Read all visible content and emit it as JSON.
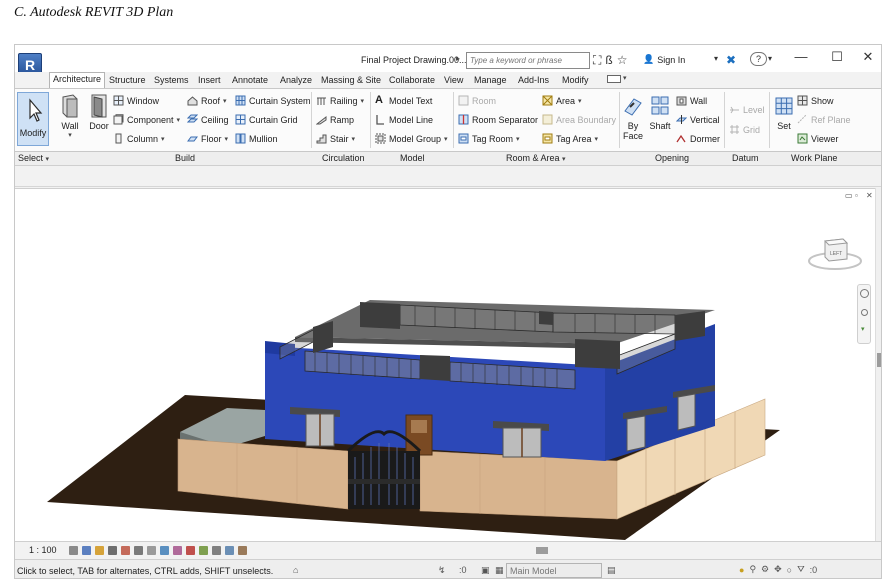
{
  "caption": "C.    Autodesk REVIT 3D Plan",
  "titlebar": {
    "logo": "R",
    "document_title": "Final Project Drawing.00...",
    "search_placeholder": "Type a keyword or phrase",
    "sign_in": "Sign In"
  },
  "tabs": [
    "Architecture",
    "Structure",
    "Systems",
    "Insert",
    "Annotate",
    "Analyze",
    "Massing & Site",
    "Collaborate",
    "View",
    "Manage",
    "Add-Ins",
    "Modify"
  ],
  "active_tab": "Architecture",
  "ribbon": {
    "select": {
      "modify": "Modify",
      "title": "Select"
    },
    "build": {
      "title": "Build",
      "wall": "Wall",
      "door": "Door",
      "window": "Window",
      "component": "Component",
      "column": "Column",
      "roof": "Roof",
      "ceiling": "Ceiling",
      "floor": "Floor",
      "curtain_system": "Curtain System",
      "curtain_grid": "Curtain Grid",
      "mullion": "Mullion"
    },
    "circulation": {
      "title": "Circulation",
      "railing": "Railing",
      "ramp": "Ramp",
      "stair": "Stair"
    },
    "model": {
      "title": "Model",
      "model_text": "Model  Text",
      "model_line": "Model  Line",
      "model_group": "Model  Group"
    },
    "room_area": {
      "title": "Room & Area",
      "room": "Room",
      "room_separator": "Room  Separator",
      "tag_room": "Tag  Room",
      "area": "Area",
      "area_boundary": "Area  Boundary",
      "tag_area": "Tag  Area"
    },
    "opening": {
      "title": "Opening",
      "by_face_1": "By",
      "by_face_2": "Face",
      "shaft": "Shaft",
      "wall": "Wall",
      "vertical": "Vertical",
      "dormer": "Dormer"
    },
    "datum": {
      "title": "Datum",
      "level": "Level",
      "grid": "Grid"
    },
    "work_plane": {
      "title": "Work Plane",
      "set": "Set",
      "show": "Show",
      "ref_plane": "Ref  Plane",
      "viewer": "Viewer"
    }
  },
  "viewcube": {
    "face_label": "LEFT"
  },
  "viewbar": {
    "scale": "1 : 100"
  },
  "statusbar": {
    "hint": "Click to select, TAB for alternates, CTRL adds, SHIFT unselects.",
    "count": ":0",
    "model": "Main Model",
    "filter_count": ":0"
  },
  "colors": {
    "ribbon_bg": "#fbfbfb",
    "walls_blue": "#2c48b8",
    "boundary_wall": "#d8b48e",
    "ground": "#2e1f12",
    "roof": "#6b6b6b"
  }
}
